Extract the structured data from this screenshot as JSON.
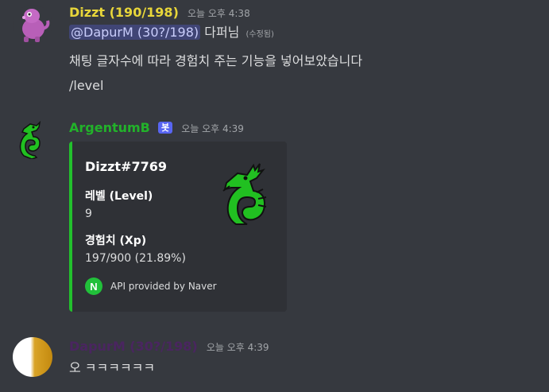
{
  "messages": [
    {
      "username": "Dizzt (190/198)",
      "username_color": "#e8d63a",
      "timestamp": "오늘 오후 4:38",
      "mention": "@DapurM (30?/198)",
      "mention_rest": " 다퍼님",
      "edited": "(수정됨)",
      "line2": "채팅 글자수에 따라 경험치 주는 기능을 넣어보았습니다",
      "line3": "/level"
    },
    {
      "username": "ArgentumB",
      "username_color": "#22b22a",
      "bot_tag": "봇",
      "timestamp": "오늘 오후 4:39",
      "embed": {
        "color": "#22c02c",
        "title": "Dizzt#7769",
        "fields": [
          {
            "name": "레벨 (Level)",
            "value": "9"
          },
          {
            "name": "경험치 (Xp)",
            "value": "197/900 (21.89%)"
          }
        ],
        "footer_icon": "naver-icon",
        "footer_icon_letter": "N",
        "footer": "API provided by Naver"
      }
    },
    {
      "username": "DapurM (30?/198)",
      "username_color": "#4a2560",
      "timestamp": "오늘 오후 4:39",
      "text": "오 ㅋㅋㅋㅋㅋㅋ"
    }
  ]
}
